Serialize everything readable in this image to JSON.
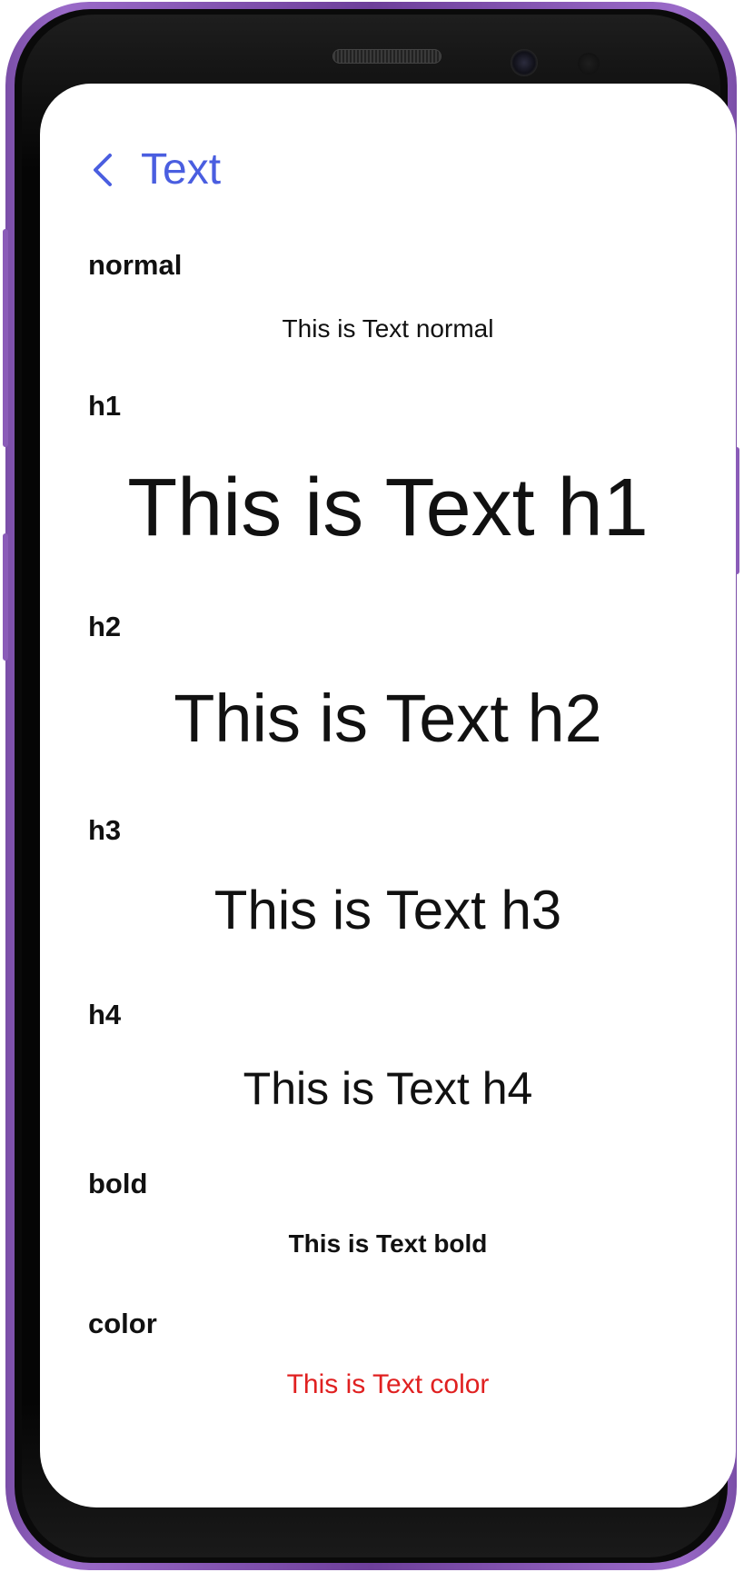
{
  "header": {
    "back_icon": "chevron-left-icon",
    "title": "Text"
  },
  "sections": [
    {
      "label": "normal",
      "sample": "This is Text normal"
    },
    {
      "label": "h1",
      "sample": "This is Text h1"
    },
    {
      "label": "h2",
      "sample": "This is Text h2"
    },
    {
      "label": "h3",
      "sample": "This is Text h3"
    },
    {
      "label": "h4",
      "sample": "This is Text h4"
    },
    {
      "label": "bold",
      "sample": "This is Text bold"
    },
    {
      "label": "color",
      "sample": "This is Text color"
    }
  ],
  "colors": {
    "accent": "#4a5ee0",
    "text": "#111111",
    "sample_color": "#e02020",
    "device_frame": "#7b4fa8"
  }
}
